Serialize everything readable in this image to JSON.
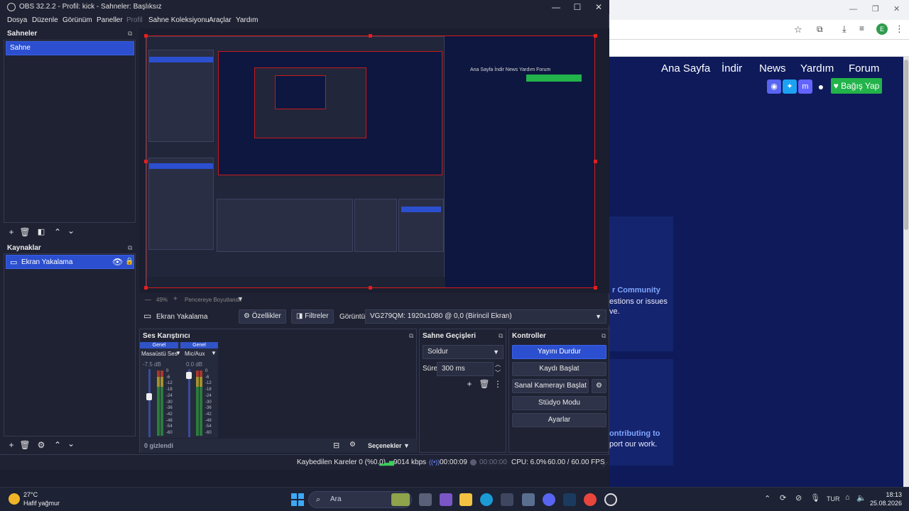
{
  "window": {
    "title": "OBS 32.2.2 - Profil: kick - Sahneler: Başlıksız",
    "controls": [
      "—",
      "☐",
      "✕"
    ]
  },
  "menu": [
    "Dosya",
    "Düzenle",
    "Görünüm",
    "Paneller",
    "Profil",
    "Sahne Koleksiyonu",
    "Araçlar",
    "Yardım"
  ],
  "scenes": {
    "title": "Sahneler",
    "items": [
      "Sahne"
    ]
  },
  "sources": {
    "title": "Kaynaklar",
    "items": [
      "Ekran Yakalama"
    ]
  },
  "preview": {
    "zoom": "49%",
    "zoom_mode": "Pencereye Boyutlandır"
  },
  "source_toolbar": {
    "source_name": "Ekran Yakalama",
    "properties": "Özellikler",
    "filters": "Filtreler",
    "display_label": "Görüntü",
    "display_value": "VG279QM: 1920x1080 @ 0,0 (Birincil Ekran)"
  },
  "mixer": {
    "title": "Ses Karıştırıcı",
    "channels": [
      {
        "tab": "Genel",
        "name": "Masaüstü Ses",
        "db": "-7.5 dB",
        "level": 0.6
      },
      {
        "tab": "Genel",
        "name": "Mic/Aux",
        "db": "0.0 dB",
        "level": 0.95
      }
    ],
    "ticks": [
      "0",
      "-6",
      "-12",
      "-18",
      "-24",
      "-30",
      "-36",
      "-42",
      "-48",
      "-54",
      "-60"
    ],
    "hidden": "0 gizlendi",
    "options": "Seçenekler"
  },
  "transitions": {
    "title": "Sahne Geçişleri",
    "type": "Soldur",
    "duration_label": "Süre",
    "duration": "300 ms"
  },
  "controls": {
    "title": "Kontroller",
    "stop_stream": "Yayını Durdur",
    "start_recording": "Kaydı Başlat",
    "virtual_cam": "Sanal Kamerayı Başlat",
    "studio_mode": "Stüdyo Modu",
    "settings": "Ayarlar"
  },
  "status": {
    "dropped": "Kaybedilen Kareler 0 (%0.0)",
    "bitrate": "9014 kbps",
    "stream_time": "00:00:09",
    "rec_time": "00:00:00",
    "cpu": "CPU: 6.0%",
    "fps": "60.00 / 60.00 FPS"
  },
  "background_page": {
    "nav": [
      "Ana Sayfa",
      "İndir",
      "News",
      "Yardım",
      "Forum"
    ],
    "donate": "Bağış Yap",
    "lines": [
      "r Community",
      "estions or issues",
      "ve.",
      "ontributing to",
      "port our work."
    ]
  },
  "taskbar": {
    "weather_temp": "27°C",
    "weather_desc": "Hafif yağmur",
    "search": "Ara",
    "lang": "TUR",
    "time": "18:13",
    "date": "25.08.2026"
  },
  "colors": {
    "accent": "#2b4fcf",
    "recording_border": "#d31b1b",
    "donate": "#22b34a",
    "web_bg": "#0e1a5a"
  }
}
